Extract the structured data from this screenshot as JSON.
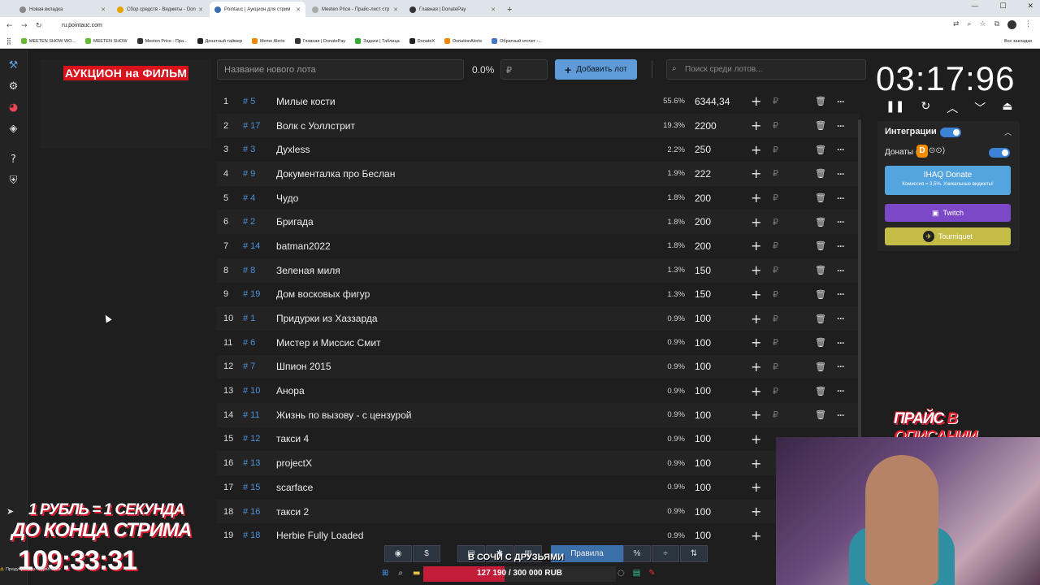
{
  "browser": {
    "tabs": [
      {
        "label": "Новая вкладка",
        "active": false
      },
      {
        "label": "Сбор средств - Виджеты - Don",
        "active": false
      },
      {
        "label": "Pointauc | Аукцион для стрим",
        "active": true
      },
      {
        "label": "Meeten Price - Прайс-лист стр",
        "active": false
      },
      {
        "label": "Главная | DonatePay",
        "active": false
      }
    ],
    "url": "ru.pointauc.com",
    "bookmarks": [
      "MEETEN SHOW WO...",
      "MEETEN SHOW",
      "Meeten Price - Пра...",
      "Донатный таймер",
      "Meme Alerts",
      "Главная | DonatePay",
      "Задачи | Таблица",
      "DonateX",
      "DonationAlerts",
      "Обратный отсчет -..."
    ],
    "all_bookmarks": "Все закладки"
  },
  "app": {
    "cover_title": "АУКЦИОН на ФИЛЬМ",
    "lot_placeholder": "Название нового лота",
    "percent": "0.0%",
    "currency_placeholder": "₽",
    "add_button": "Добавить лот",
    "search_placeholder": "Поиск среди лотов...",
    "lots": [
      {
        "n": "1",
        "id": "# 5",
        "name": "Милые кости",
        "pct": "55.6%",
        "amount": "6344,34"
      },
      {
        "n": "2",
        "id": "# 17",
        "name": "Волк с Уоллстрит",
        "pct": "19.3%",
        "amount": "2200"
      },
      {
        "n": "3",
        "id": "# 3",
        "name": "Дyxless",
        "pct": "2.2%",
        "amount": "250"
      },
      {
        "n": "4",
        "id": "# 9",
        "name": "Документалка про Беслан",
        "pct": "1.9%",
        "amount": "222"
      },
      {
        "n": "5",
        "id": "# 4",
        "name": "Чудо",
        "pct": "1.8%",
        "amount": "200"
      },
      {
        "n": "6",
        "id": "# 2",
        "name": "Бригада",
        "pct": "1.8%",
        "amount": "200"
      },
      {
        "n": "7",
        "id": "# 14",
        "name": "batman2022",
        "pct": "1.8%",
        "amount": "200"
      },
      {
        "n": "8",
        "id": "# 8",
        "name": "Зеленая миля",
        "pct": "1.3%",
        "amount": "150"
      },
      {
        "n": "9",
        "id": "# 19",
        "name": "Дом восковых фигур",
        "pct": "1.3%",
        "amount": "150"
      },
      {
        "n": "10",
        "id": "# 1",
        "name": "Придурки из Хаззарда",
        "pct": "0.9%",
        "amount": "100"
      },
      {
        "n": "11",
        "id": "# 6",
        "name": "Мистер и Миссис Смит",
        "pct": "0.9%",
        "amount": "100"
      },
      {
        "n": "12",
        "id": "# 7",
        "name": "Шпион 2015",
        "pct": "0.9%",
        "amount": "100"
      },
      {
        "n": "13",
        "id": "# 10",
        "name": "Анора",
        "pct": "0.9%",
        "amount": "100"
      },
      {
        "n": "14",
        "id": "# 11",
        "name": "Жизнь по вызову - с цензурой",
        "pct": "0.9%",
        "amount": "100"
      },
      {
        "n": "15",
        "id": "# 12",
        "name": "такси 4",
        "pct": "0.9%",
        "amount": "100"
      },
      {
        "n": "16",
        "id": "# 13",
        "name": "projectX",
        "pct": "0.9%",
        "amount": "100"
      },
      {
        "n": "17",
        "id": "# 15",
        "name": "scarface",
        "pct": "0.9%",
        "amount": "100"
      },
      {
        "n": "18",
        "id": "# 16",
        "name": "такси 2",
        "pct": "0.9%",
        "amount": "100"
      },
      {
        "n": "19",
        "id": "# 18",
        "name": "Herbie Fully Loaded",
        "pct": "0.9%",
        "amount": "100"
      }
    ],
    "timer": "03:17:96",
    "integrations_title": "Интеграции",
    "donates_label": "Донаты (",
    "donates_suffix": ")",
    "ihaq_title": "IHAQ Donate",
    "ihaq_subtitle": "Комиссия = 3,5%. Уникальные виджеты!",
    "twitch_label": "Twitch",
    "tourniquet_label": "Tourniquet",
    "rules_label": "Правила"
  },
  "overlay": {
    "price_text": "ПРАЙС",
    "price_text2": "В ОПИСАНИИ",
    "rub_line": "1 РУБЛЬ = 1 СЕКУНДА",
    "end_line": "ДО КОНЦА СТРИМА",
    "stream_timer": "109:33:31",
    "goal_title": "В СОЧИ С ДРУЗЬЯМИ",
    "goal_text": "127 190 / 300 000 RUB",
    "goal_progress": 0.424,
    "warning": "Предупрежден в действии"
  },
  "colors": {
    "accent": "#5e9bd8",
    "cover_red": "#d8131b",
    "twitch": "#7d48c8",
    "tourniquet": "#c3bd47",
    "ihaq": "#54a4e0",
    "goal_fill": "#c21c38"
  }
}
